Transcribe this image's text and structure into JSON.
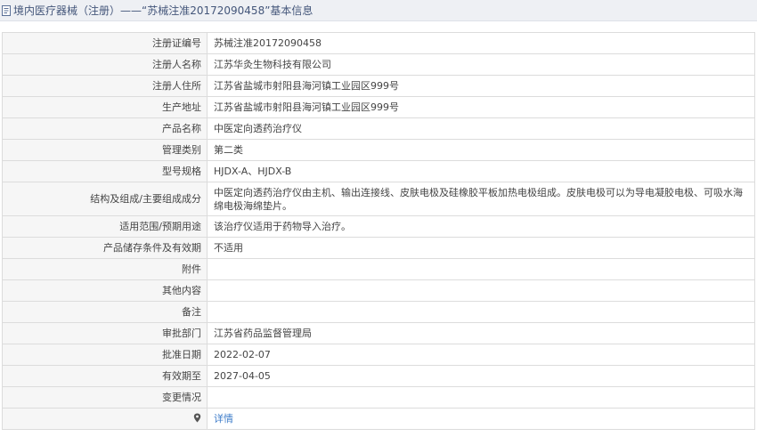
{
  "header": {
    "title": "境内医疗器械（注册）——“苏械注准20172090458”基本信息"
  },
  "rows": [
    {
      "label": "注册证编号",
      "value": "苏械注准20172090458"
    },
    {
      "label": "注册人名称",
      "value": "江苏华灸生物科技有限公司"
    },
    {
      "label": "注册人住所",
      "value": "江苏省盐城市射阳县海河镇工业园区999号"
    },
    {
      "label": "生产地址",
      "value": "江苏省盐城市射阳县海河镇工业园区999号"
    },
    {
      "label": "产品名称",
      "value": "中医定向透药治疗仪"
    },
    {
      "label": "管理类别",
      "value": "第二类"
    },
    {
      "label": "型号规格",
      "value": "HJDX-A、HJDX-B"
    },
    {
      "label": "结构及组成/主要组成成分",
      "value": "中医定向透药治疗仪由主机、输出连接线、皮肤电极及硅橡胶平板加热电极组成。皮肤电极可以为导电凝胶电极、可吸水海绵电极海绵垫片。"
    },
    {
      "label": "适用范围/预期用途",
      "value": "该治疗仪适用于药物导入治疗。"
    },
    {
      "label": "产品储存条件及有效期",
      "value": "不适用"
    },
    {
      "label": "附件",
      "value": ""
    },
    {
      "label": "其他内容",
      "value": ""
    },
    {
      "label": "备注",
      "value": ""
    },
    {
      "label": "审批部门",
      "value": "江苏省药品监督管理局"
    },
    {
      "label": "批准日期",
      "value": "2022-02-07"
    },
    {
      "label": "有效期至",
      "value": "2027-04-05"
    },
    {
      "label": "变更情况",
      "value": ""
    }
  ],
  "last_row": {
    "label": "",
    "link_text": "详情",
    "icon": "map-pin-icon"
  },
  "colors": {
    "header_bg": "#eef0f4",
    "header_text": "#44567a",
    "label_bg": "#f6f6f6",
    "border": "#dcdcdc",
    "link": "#3d7cc9"
  }
}
